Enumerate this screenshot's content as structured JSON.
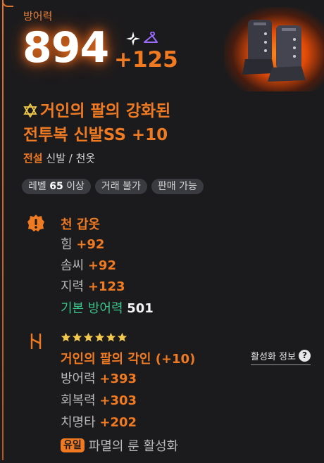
{
  "header": {
    "defense_label": "방어력",
    "defense_value": "894",
    "defense_bonus": "+125"
  },
  "item": {
    "name_line1": "거인의 팔의 강화된",
    "name_line2": "전투복 신발SS +10",
    "grade": "전설",
    "category": "신발 / 천옷"
  },
  "tags": [
    {
      "prefix": "레벨",
      "value": "65",
      "suffix": "이상"
    },
    {
      "label": "거래 불가"
    },
    {
      "label": "판매 가능"
    }
  ],
  "armor_section": {
    "title": "천 갑옷",
    "stats": [
      {
        "label": "힘 ",
        "value": "+92"
      },
      {
        "label": "솜씨 ",
        "value": "+92"
      },
      {
        "label": "지력 ",
        "value": "+123"
      }
    ],
    "base": {
      "label": "기본 방어력 ",
      "value": "501"
    }
  },
  "engraving": {
    "star_count": 6,
    "title": "거인의 팔의 각인 (+10)",
    "activation_label": "활성화 정보",
    "stats": [
      {
        "label": "방어력 ",
        "value": "+393"
      },
      {
        "label": "회복력 ",
        "value": "+303"
      },
      {
        "label": "치명타 ",
        "value": "+202"
      }
    ],
    "unique_badge": "유일",
    "unique_text": "파멸의 룬 활성화"
  },
  "colors": {
    "accent": "#f07a22",
    "base_stat": "#3cc48a",
    "background": "#1b1b1d"
  },
  "icons": {
    "star": "sparkle-star-icon",
    "hanger": "hanger-icon",
    "section": "armor-badge-icon",
    "rune": "rune-icon",
    "help": "question-icon"
  }
}
